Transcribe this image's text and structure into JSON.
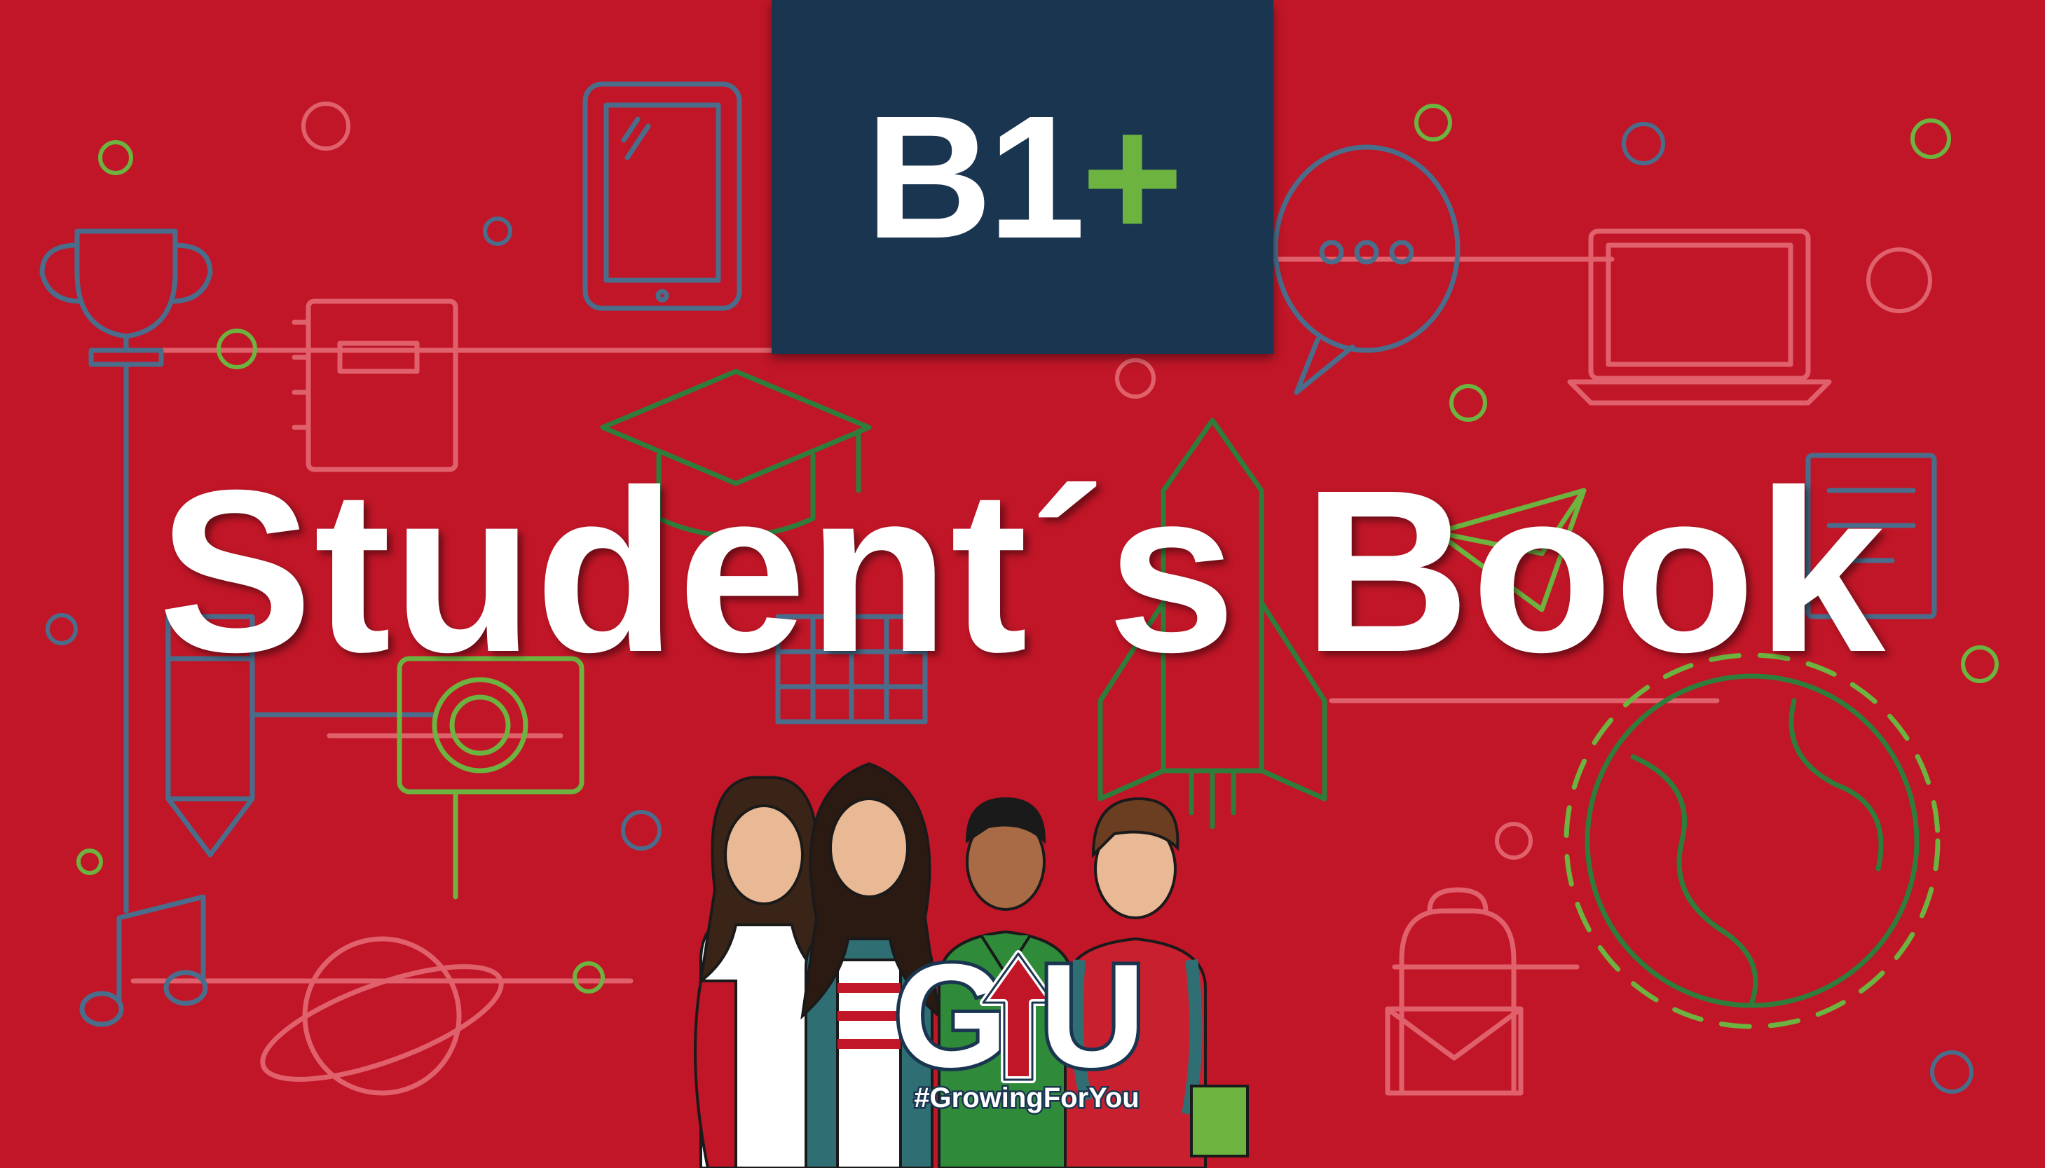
{
  "level": {
    "main": "B1",
    "plus": "+"
  },
  "title": "Student´s Book",
  "logo": {
    "g": "G",
    "u": "U",
    "hashtag": "#GrowingForYou"
  },
  "colors": {
    "background": "#c01627",
    "navy": "#1a3550",
    "green": "#6cb33f",
    "line_blue": "#4a6d8c",
    "line_pink": "#e0616c"
  },
  "icons": [
    "trophy-icon",
    "notebook-icon",
    "tablet-icon",
    "chat-bubble-icon",
    "laptop-icon",
    "graduation-cap-icon",
    "rocket-icon",
    "paper-plane-icon",
    "document-icon",
    "pencil-icon",
    "camera-icon",
    "calendar-icon",
    "globe-icon",
    "planet-icon",
    "music-note-icon",
    "backpack-icon",
    "envelope-icon"
  ]
}
